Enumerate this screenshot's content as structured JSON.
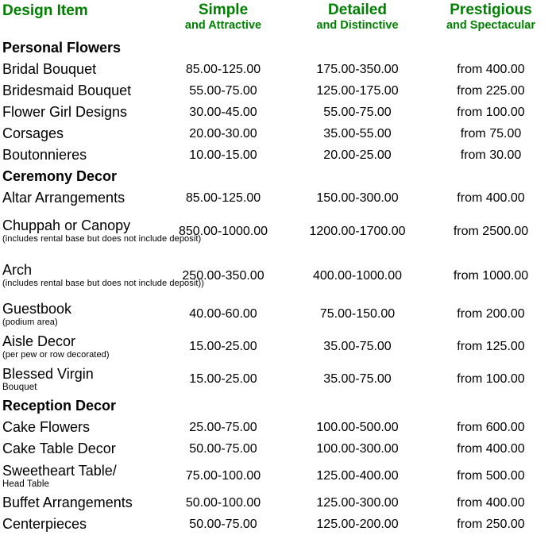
{
  "accent_color": "#008000",
  "header": {
    "item_label": "Design Item",
    "columns": [
      {
        "main": "Simple",
        "sub": "and Attractive"
      },
      {
        "main": "Detailed",
        "sub": "and Distinctive"
      },
      {
        "main": "Prestigious",
        "sub": "and Spectacular"
      }
    ]
  },
  "rows": [
    {
      "kind": "section",
      "item": "Personal Flowers"
    },
    {
      "kind": "item",
      "item": "Bridal Bouquet",
      "simple": "85.00-125.00",
      "detailed": "175.00-350.00",
      "prestigious": "from 400.00"
    },
    {
      "kind": "item",
      "item": "Bridesmaid Bouquet",
      "simple": "55.00-75.00",
      "detailed": "125.00-175.00",
      "prestigious": "from 225.00"
    },
    {
      "kind": "item",
      "item": "Flower Girl Designs",
      "simple": "30.00-45.00",
      "detailed": "55.00-75.00",
      "prestigious": "from 100.00"
    },
    {
      "kind": "item",
      "item": "Corsages",
      "simple": "20.00-30.00",
      "detailed": "35.00-55.00",
      "prestigious": "from 75.00"
    },
    {
      "kind": "item",
      "item": "Boutonnieres",
      "simple": "10.00-15.00",
      "detailed": "20.00-25.00",
      "prestigious": "from 30.00"
    },
    {
      "kind": "section",
      "item": "Ceremony Decor"
    },
    {
      "kind": "item",
      "item": "Altar Arrangements",
      "simple": "85.00-125.00",
      "detailed": "150.00-300.00",
      "prestigious": "from 400.00"
    },
    {
      "kind": "item",
      "item": "Chuppah or Canopy",
      "note": "(includes rental base but does not include deposit)",
      "note_style": "paren",
      "simple": "850.00-1000.00",
      "detailed": "1200.00-1700.00",
      "prestigious": "from 2500.00"
    },
    {
      "kind": "item",
      "item": "Arch",
      "note": "(includes rental base but does not include deposit))",
      "note_style": "paren",
      "simple": "250.00-350.00",
      "detailed": "400.00-1000.00",
      "prestigious": "from 1000.00"
    },
    {
      "kind": "item",
      "item": "Guestbook",
      "note": "(podium area)",
      "note_style": "paren",
      "simple": "40.00-60.00",
      "detailed": "75.00-150.00",
      "prestigious": "from 200.00"
    },
    {
      "kind": "item",
      "item": "Aisle Decor",
      "note": "(per pew or row decorated)",
      "note_style": "paren",
      "simple": "15.00-25.00",
      "detailed": "35.00-75.00",
      "prestigious": "from 125.00"
    },
    {
      "kind": "item",
      "item": "Blessed Virgin",
      "note": "Bouquet",
      "note_style": "plain",
      "simple": "15.00-25.00",
      "detailed": "35.00-75.00",
      "prestigious": "from 100.00"
    },
    {
      "kind": "section",
      "item": "Reception Decor"
    },
    {
      "kind": "item",
      "item": "Cake Flowers",
      "simple": "25.00-75.00",
      "detailed": "100.00-500.00",
      "prestigious": "from 600.00"
    },
    {
      "kind": "item",
      "item": "Cake Table Decor",
      "simple": "50.00-75.00",
      "detailed": "100.00-300.00",
      "prestigious": "from 400.00"
    },
    {
      "kind": "item",
      "item": "Sweetheart Table/",
      "note": "Head Table",
      "note_style": "plain",
      "simple": "75.00-100.00",
      "detailed": "125.00-400.00",
      "prestigious": "from 500.00"
    },
    {
      "kind": "item",
      "item": "Buffet Arrangements",
      "simple": "50.00-100.00",
      "detailed": "125.00-300.00",
      "prestigious": "from 400.00"
    },
    {
      "kind": "item",
      "item": "Centerpieces",
      "simple": "50.00-75.00",
      "detailed": "125.00-200.00",
      "prestigious": "from 250.00"
    }
  ]
}
